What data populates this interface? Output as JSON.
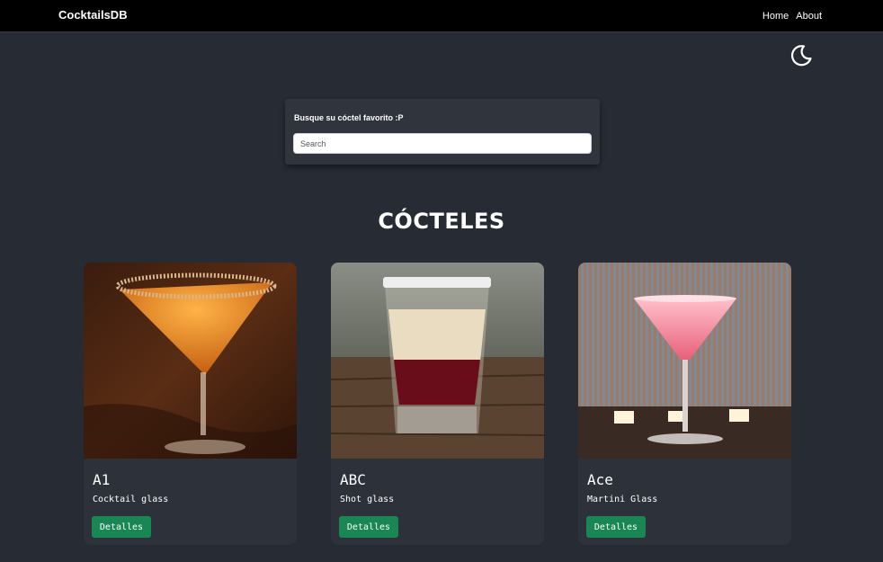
{
  "navbar": {
    "brand": "CocktailsDB",
    "links": [
      {
        "label": "Home"
      },
      {
        "label": "About"
      }
    ]
  },
  "theme_toggle": {
    "icon": "moon-icon"
  },
  "search": {
    "label": "Busque su cóctel favorito :P",
    "placeholder": "Search",
    "value": ""
  },
  "main": {
    "title": "CÓCTELES"
  },
  "cards": [
    {
      "name": "A1",
      "glass": "Cocktail glass",
      "button": "Detalles",
      "image": "amber-martini-photo"
    },
    {
      "name": "ABC",
      "glass": "Shot glass",
      "button": "Detalles",
      "image": "layered-shot-photo"
    },
    {
      "name": "Ace",
      "glass": "Martini Glass",
      "button": "Detalles",
      "image": "pink-martini-photo"
    }
  ],
  "colors": {
    "background": "#272b33",
    "navbar": "#000000",
    "card": "#2d313a",
    "button": "#198754"
  }
}
